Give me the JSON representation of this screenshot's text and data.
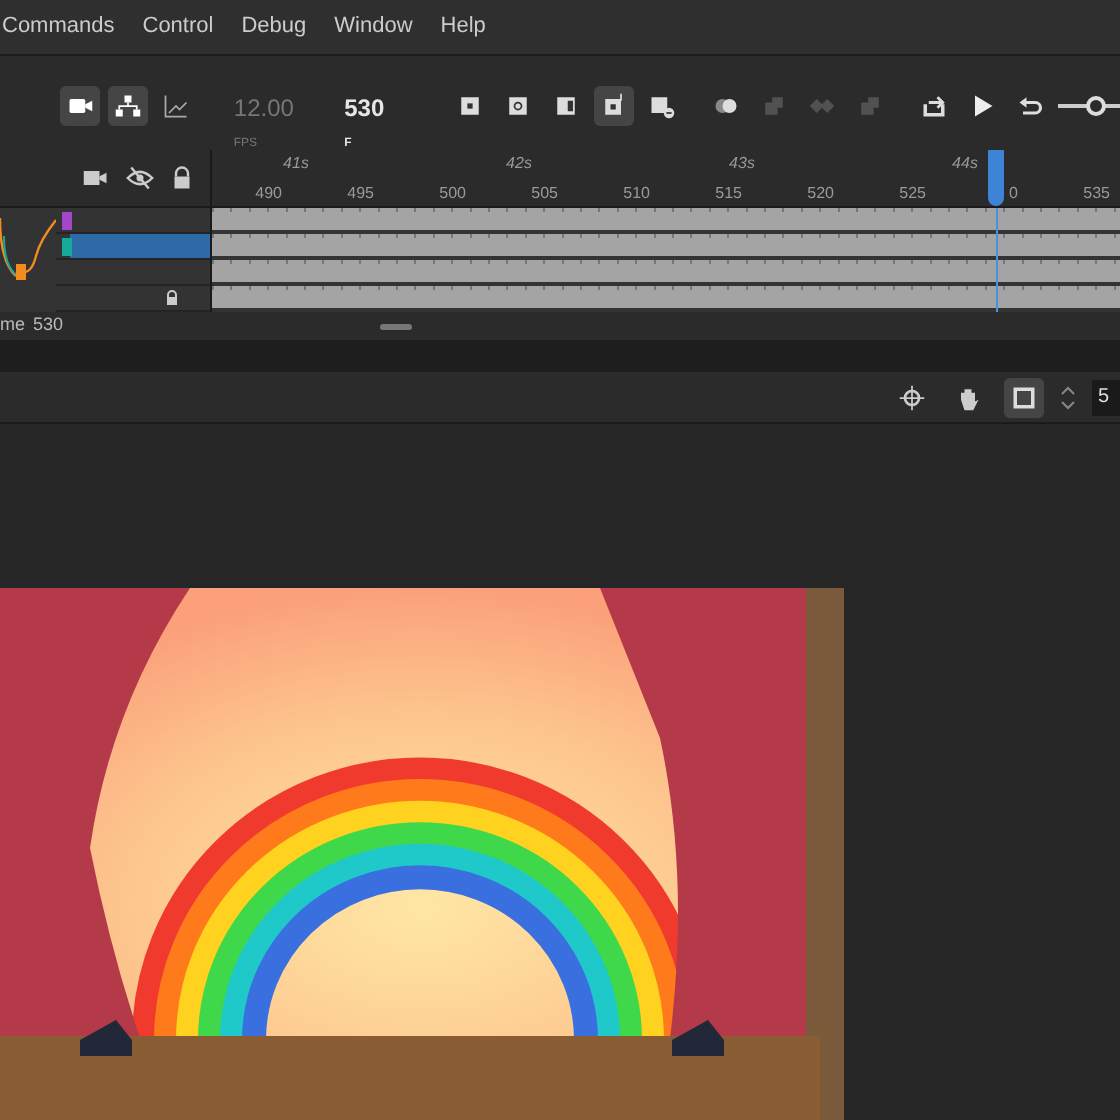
{
  "menu": [
    "Commands",
    "Control",
    "Debug",
    "Window",
    "Help"
  ],
  "timeline_toolbar": {
    "view_tools": [
      {
        "selected": true
      },
      {
        "selected": true
      },
      {
        "selected": false
      }
    ],
    "fps": "12.00",
    "fps_unit": "FPS",
    "frame": "530",
    "frame_unit": "F",
    "controls": [
      {
        "selected": false,
        "disabled": false
      },
      {
        "selected": false,
        "disabled": false
      },
      {
        "selected": false,
        "disabled": false
      },
      {
        "selected": true,
        "disabled": false
      },
      {
        "selected": false,
        "disabled": false
      },
      {
        "selected": false,
        "disabled": false
      },
      {
        "selected": false,
        "disabled": true
      },
      {
        "selected": false,
        "disabled": true
      },
      {
        "selected": false,
        "disabled": true
      },
      {
        "selected": false,
        "disabled": false
      },
      {
        "selected": false,
        "disabled": false
      },
      {
        "selected": false,
        "disabled": false
      }
    ],
    "zoom_slider": {
      "level": 0.6
    }
  },
  "ruler": {
    "seconds": [
      "41s",
      "42s",
      "43s",
      "44s"
    ],
    "frames": [
      "490",
      "495",
      "500",
      "505",
      "510",
      "515",
      "520",
      "525",
      "0",
      "535"
    ],
    "playhead": {
      "level": 0.863
    }
  },
  "layers": [
    {
      "selected": false,
      "locked": false,
      "color": "#a346c9"
    },
    {
      "selected": true,
      "locked": false,
      "color": "#17a99b"
    },
    {
      "selected": false,
      "locked": false
    },
    {
      "selected": false,
      "locked": true
    }
  ],
  "status": {
    "label": "me",
    "value": "530"
  },
  "stage_toolbar": {
    "tools": [
      {
        "selected": false
      },
      {
        "selected": false
      },
      {
        "selected": true
      }
    ],
    "zoom_value": "5"
  }
}
